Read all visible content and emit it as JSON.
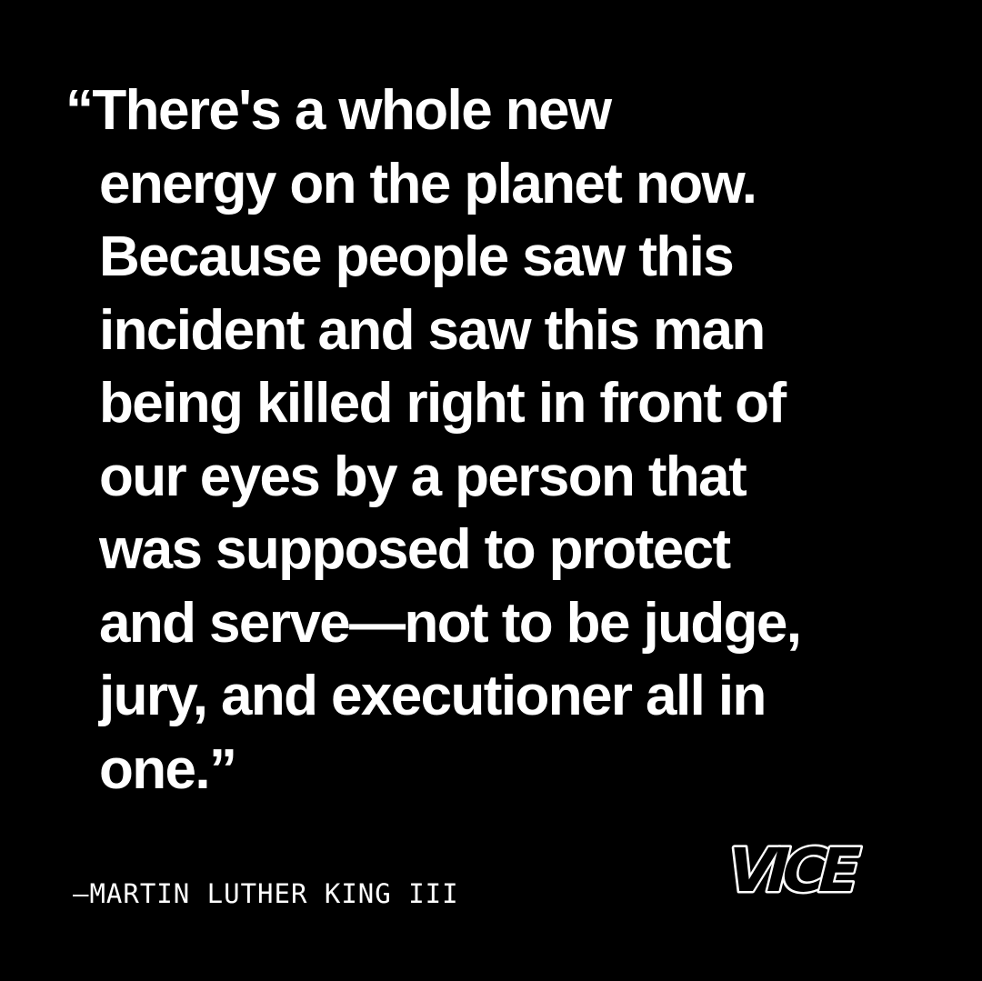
{
  "quote": {
    "lines": [
      "“There's a whole new",
      "energy on the planet now.",
      "Because people saw this",
      "incident and saw this man",
      "being killed right in front of",
      "our eyes by a person that",
      "was supposed to protect",
      "and serve—not to be judge,",
      "jury, and executioner all in",
      "one.”"
    ]
  },
  "attribution": "—MARTIN LUTHER KING III",
  "logo": {
    "text": "VICE",
    "fill": "#000000",
    "outline": "#ffffff"
  },
  "colors": {
    "background": "#000000",
    "text": "#ffffff"
  }
}
